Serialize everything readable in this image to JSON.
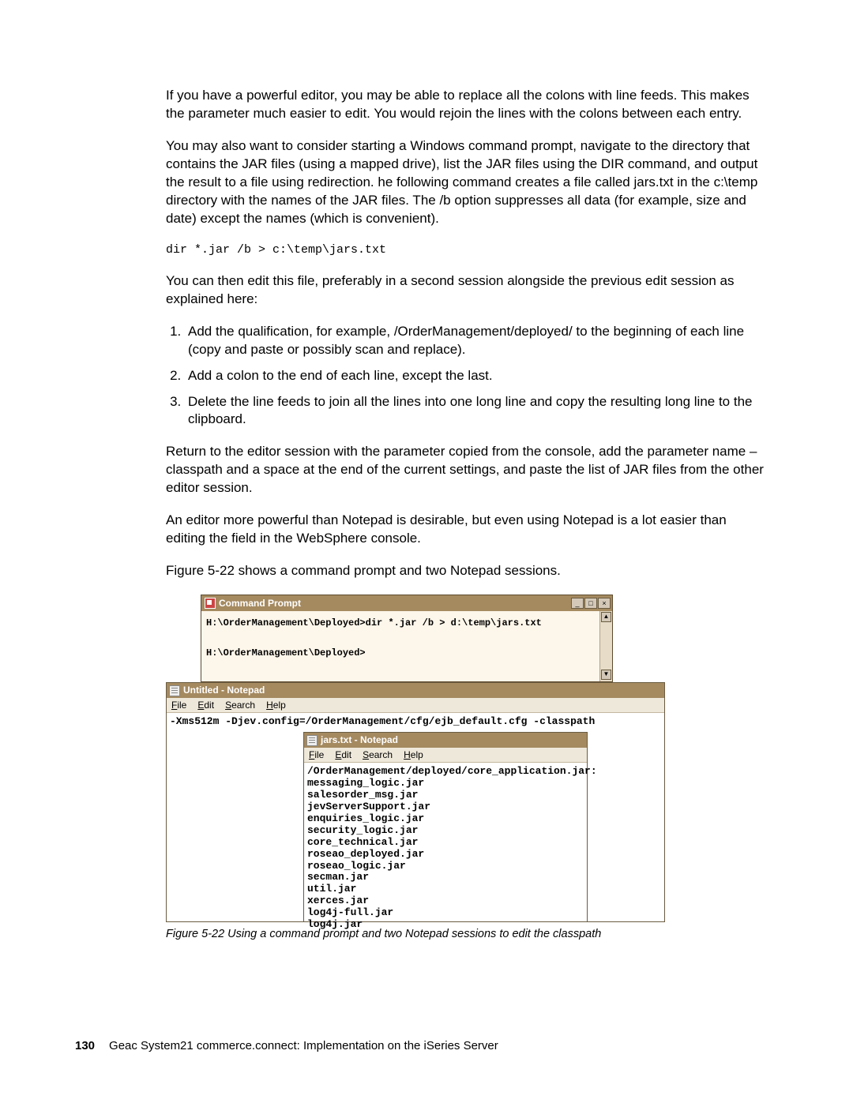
{
  "paragraphs": {
    "p1": "If you have a powerful editor, you may be able to replace all the colons with line feeds. This makes the parameter much easier to edit. You would rejoin the lines with the colons between each entry.",
    "p2": "You may also want to consider starting a Windows command prompt, navigate to the directory that contains the JAR files (using a mapped drive), list the JAR files using the DIR command, and output the result to a file using redirection. he following command creates a file called jars.txt in the c:\\temp directory with the names of the JAR files. The /b option suppresses all data (for example, size and date) except the names (which is convenient).",
    "code1": "dir *.jar /b > c:\\temp\\jars.txt",
    "p3": "You can then edit this file, preferably in a second session alongside the previous edit session as explained here:",
    "step1": "Add the qualification, for example, /OrderManagement/deployed/ to the beginning of each line (copy and paste or possibly scan and replace).",
    "step2": "Add a colon to the end of each line, except the last.",
    "step3": "Delete the line feeds to join all the lines into one long line and copy the resulting long line to the clipboard.",
    "p4": "Return to the editor session with the parameter copied from the console, add the parameter name –classpath and a space at the end of the current settings, and paste the list of JAR files from the other editor session.",
    "p5": "An editor more powerful than Notepad is desirable, but even using Notepad is a lot easier than editing the field in the WebSphere console.",
    "p6": "Figure 5-22 shows a command prompt and two Notepad sessions."
  },
  "cmd": {
    "title": "Command Prompt",
    "line1": "H:\\OrderManagement\\Deployed>dir *.jar /b > d:\\temp\\jars.txt",
    "line2": "H:\\OrderManagement\\Deployed>"
  },
  "np1": {
    "title": "Untitled - Notepad",
    "menu": {
      "file": "File",
      "edit": "Edit",
      "search": "Search",
      "help": "Help"
    },
    "content": "-Xms512m -Djev.config=/OrderManagement/cfg/ejb_default.cfg -classpath"
  },
  "np2": {
    "title": "jars.txt - Notepad",
    "menu": {
      "file": "File",
      "edit": "Edit",
      "search": "Search",
      "help": "Help"
    },
    "lines": [
      "/OrderManagement/deployed/core_application.jar:",
      "messaging_logic.jar",
      "salesorder_msg.jar",
      "jevServerSupport.jar",
      "enquiries_logic.jar",
      "security_logic.jar",
      "core_technical.jar",
      "roseao_deployed.jar",
      "roseao_logic.jar",
      "secman.jar",
      "util.jar",
      "xerces.jar",
      "log4j-full.jar",
      "log4j.jar"
    ]
  },
  "caption": "Figure 5-22   Using a command prompt and two Notepad sessions to edit the classpath",
  "footer": {
    "page": "130",
    "book": "Geac System21 commerce.connect: Implementation on the iSeries Server"
  },
  "glyphs": {
    "min": "_",
    "max": "□",
    "close": "×",
    "up": "▲",
    "down": "▼"
  }
}
